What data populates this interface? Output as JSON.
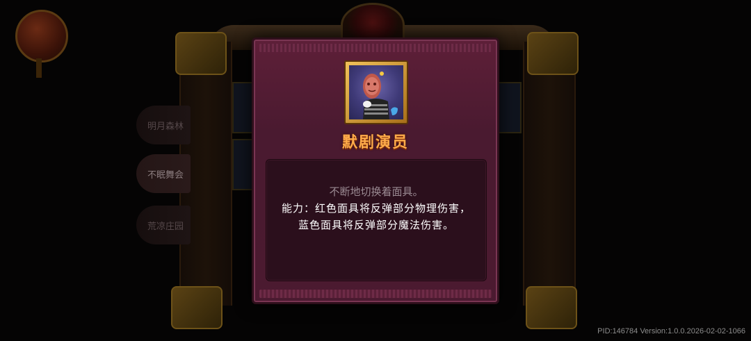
{
  "background": {
    "side_tabs": [
      {
        "label": "明月森林",
        "active": false
      },
      {
        "label": "不眠舞会",
        "active": true
      },
      {
        "label": "荒凉庄园",
        "active": false
      }
    ]
  },
  "modal": {
    "monster_name": "默剧演员",
    "portrait_icon": "mime-character-portrait",
    "flavor_text": "不断地切换着面具。",
    "ability_text": "能力：红色面具将反弹部分物理伤害，蓝色面具将反弹部分魔法伤害。"
  },
  "footer": {
    "version": "PID:146784  Version:1.0.0.2026-02-02-1066"
  },
  "colors": {
    "panel": "#4b1a30",
    "name": "#ffac4a",
    "desc_box": "#2b0f1c",
    "flavor": "#9a8a92",
    "ability": "#ffffff"
  }
}
